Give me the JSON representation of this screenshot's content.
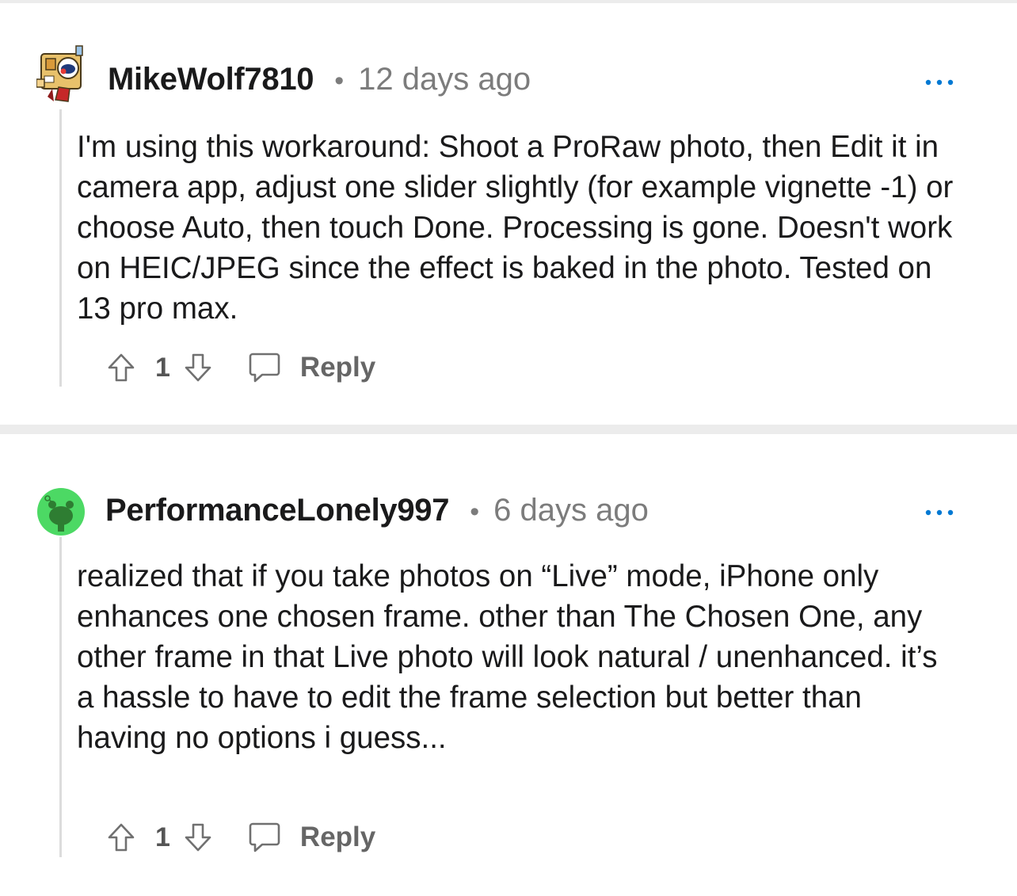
{
  "comments": [
    {
      "username": "MikeWolf7810",
      "separator": "•",
      "timestamp": "12 days ago",
      "body": "I'm using this workaround: Shoot a ProRaw photo, then Edit it in camera app, adjust one slider slightly (for example vignette -1) or choose Auto, then touch Done. Processing is gone. Doesn't work on HEIC/JPEG since the effect is baked in the photo. Tested on 13 pro max.",
      "score": "1",
      "reply_label": "Reply",
      "avatar_icon": "snoo-box-avatar-icon"
    },
    {
      "username": "PerformanceLonely997",
      "separator": "•",
      "timestamp": "6 days ago",
      "body": "realized that if you take photos on “Live” mode, iPhone only enhances one chosen frame. other than The Chosen One, any other frame in that Live photo will look natural / unenhanced. it’s a hassle to have to edit the frame selection but better than having no options i guess...",
      "score": "1",
      "reply_label": "Reply",
      "avatar_icon": "snoo-green-avatar-icon"
    }
  ],
  "icons": {
    "upvote": "upvote-arrow-icon",
    "downvote": "downvote-arrow-icon",
    "reply": "speech-bubble-icon",
    "more": "more-options-ellipsis-icon"
  },
  "colors": {
    "accent_blue": "#0079d3",
    "meta_gray": "#7c7c7c",
    "divider": "#ececec",
    "avatar_green": "#4cd964"
  }
}
